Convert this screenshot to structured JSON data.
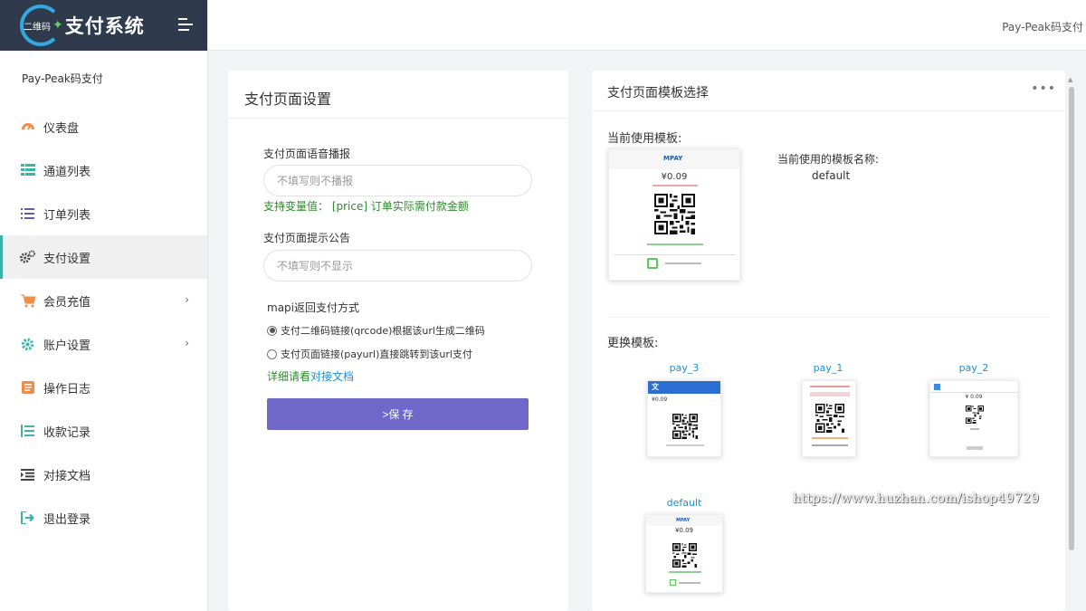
{
  "app": {
    "logo_small": "二维码",
    "logo_big": "支付系统",
    "site_name": "Pay-Peak码支付",
    "header_user": "Pay-Peak码支付"
  },
  "sidebar": {
    "items": [
      {
        "label": "仪表盘",
        "icon": "dashboard-icon",
        "color": "#f08c4a"
      },
      {
        "label": "通道列表",
        "icon": "channel-list-icon",
        "color": "#3bb4a7"
      },
      {
        "label": "订单列表",
        "icon": "order-list-icon",
        "color": "#5a5fb0"
      },
      {
        "label": "支付设置",
        "icon": "gears-icon",
        "color": "#444444"
      },
      {
        "label": "会员充值",
        "icon": "cart-icon",
        "color": "#f08c4a"
      },
      {
        "label": "账户设置",
        "icon": "gear-icon",
        "color": "#3bb4a7"
      },
      {
        "label": "操作日志",
        "icon": "log-icon",
        "color": "#f08c4a"
      },
      {
        "label": "收款记录",
        "icon": "records-icon",
        "color": "#3bb4a7"
      },
      {
        "label": "对接文档",
        "icon": "docs-icon",
        "color": "#444444"
      },
      {
        "label": "退出登录",
        "icon": "logout-icon",
        "color": "#3bb4a7"
      }
    ]
  },
  "settings_panel": {
    "title": "支付页面设置",
    "voice_label": "支付页面语音播报",
    "voice_placeholder": "不填写则不播报",
    "variable_hint": "支持变量值：  [price] 订单实际需付款金额",
    "notice_label": "支付页面提示公告",
    "notice_placeholder": "不填写则不显示",
    "mapi_label": "mapi返回支付方式",
    "option_qrcode": "支付二维码链接(qrcode)根据该url生成二维码",
    "option_payurl": "支付页面链接(payurl)直接跳转到该url支付",
    "doc_prefix": "详细请看",
    "doc_link": "对接文档",
    "save_label": ">保 存"
  },
  "template_panel": {
    "title": "支付页面模板选择",
    "more": "•••",
    "current_label": "当前使用模板:",
    "current_name_label": "当前使用的模板名称:",
    "current_name": "default",
    "change_label": "更换模板:",
    "current_price": "¥0.09",
    "templates": [
      {
        "name": "pay_3",
        "price": "¥0.09"
      },
      {
        "name": "pay_1",
        "price": ""
      },
      {
        "name": "pay_2",
        "price": "¥ 0.09"
      },
      {
        "name": "default",
        "price": "¥0.09"
      }
    ]
  },
  "watermark": "https://www.huzhan.com/ishop49729"
}
